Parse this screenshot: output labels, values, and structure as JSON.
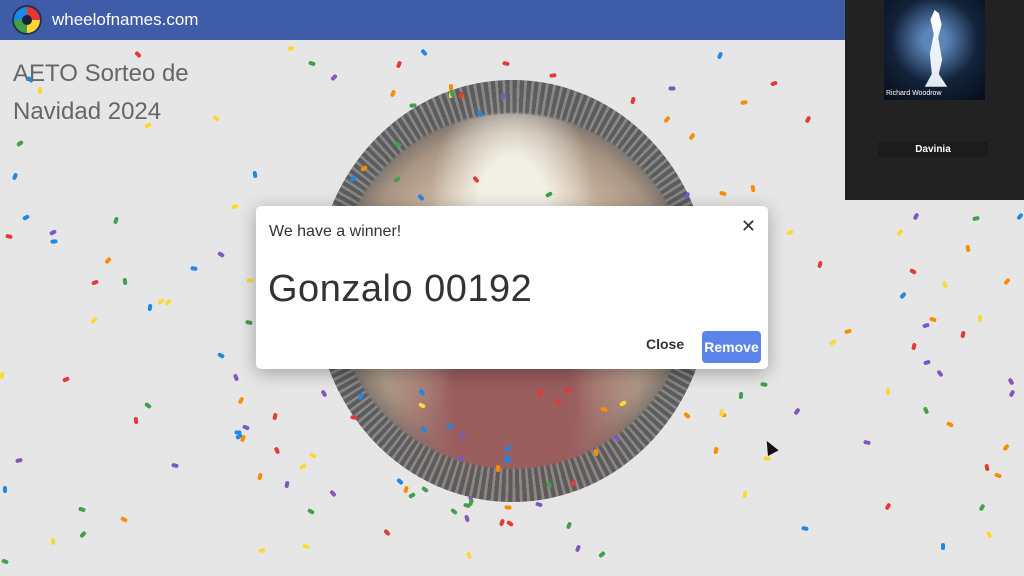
{
  "header": {
    "site_name": "wheelofnames.com",
    "logo": "wheelofnames-logo-icon"
  },
  "wheel": {
    "title": "AETO Sorteo de Navidad 2024"
  },
  "dialog": {
    "heading": "We have a winner!",
    "winner_name": "Gonzalo 00192",
    "close_label": "Close",
    "remove_label": "Remove",
    "close_icon": "close-icon"
  },
  "video_call": {
    "tile_name": "Richard Woodrow",
    "participant_label": "Davinia"
  },
  "colors": {
    "header_bg": "#3e5ca8",
    "remove_button": "#5b84e8",
    "confetti": [
      "#e53935",
      "#fdd835",
      "#43a047",
      "#1e88e5",
      "#7e57c2",
      "#fb8c00"
    ]
  }
}
